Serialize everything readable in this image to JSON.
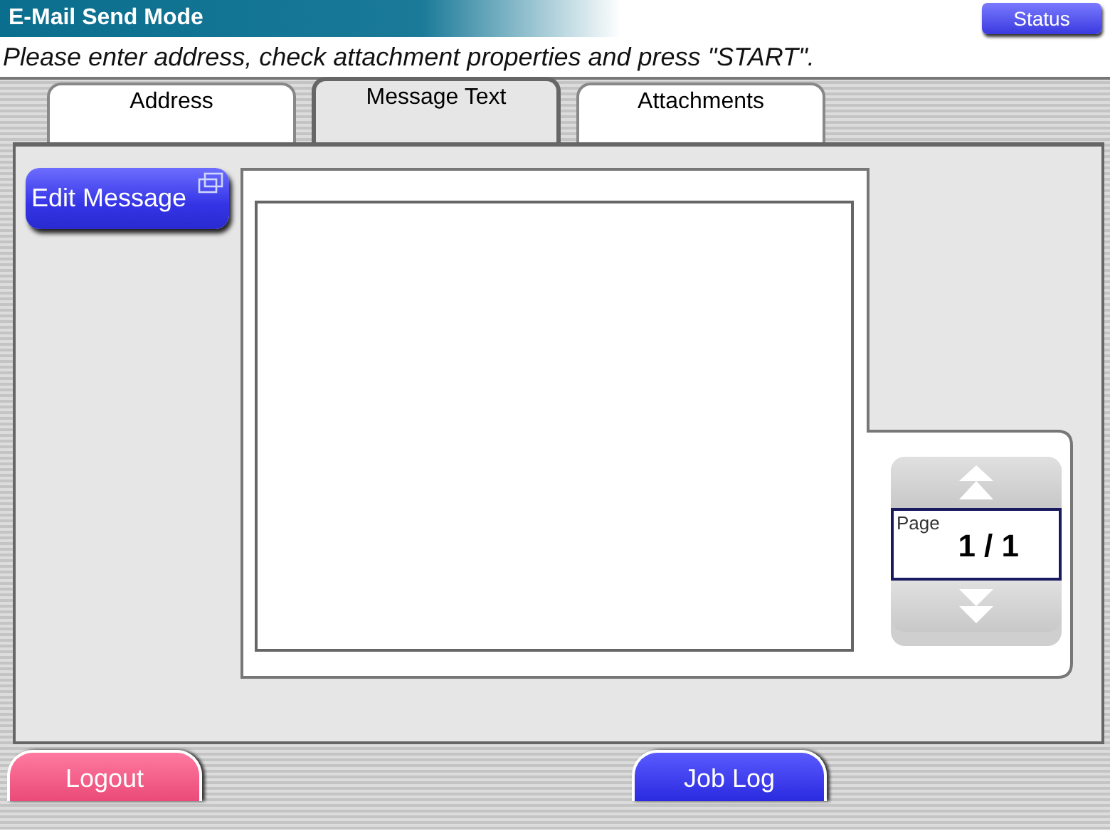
{
  "window": {
    "title": "E-Mail Send Mode"
  },
  "status_button": "Status",
  "instruction": "Please enter address, check attachment properties and press \"START\".",
  "tabs": [
    {
      "label": "Address",
      "selected": false
    },
    {
      "label": "Message Text",
      "selected": true
    },
    {
      "label": "Attachments",
      "selected": false
    }
  ],
  "edit_button": "Edit Message",
  "pager": {
    "label": "Page",
    "value": "1 / 1"
  },
  "footer_buttons": [
    {
      "label": "Logout",
      "kind": "logout"
    },
    {
      "label": "Job Log",
      "kind": "joblog"
    }
  ]
}
